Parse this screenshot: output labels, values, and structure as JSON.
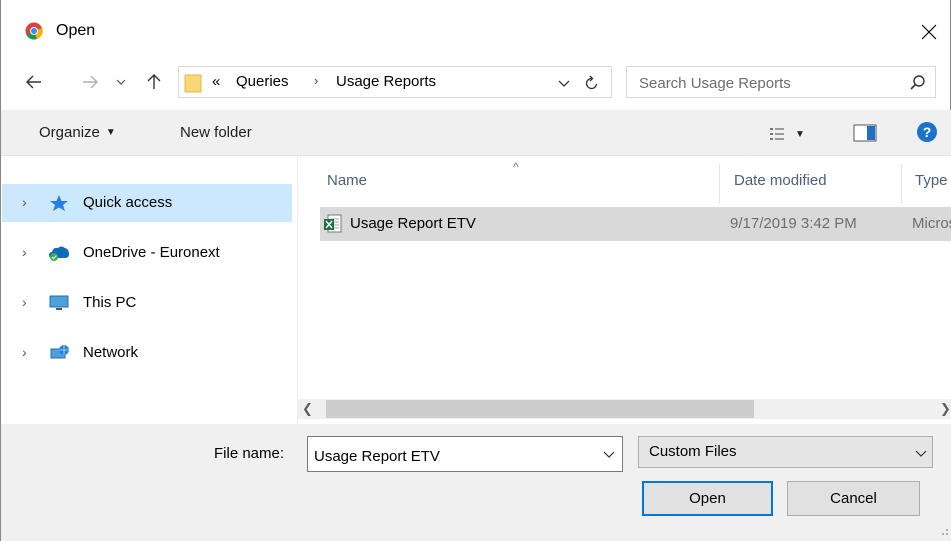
{
  "window": {
    "title": "Open",
    "app_icon": "chrome-icon",
    "close_icon": "close-icon"
  },
  "nav": {
    "back_icon": "back-arrow-icon",
    "forward_icon": "forward-arrow-icon",
    "recent_icon": "chevron-down-icon",
    "up_icon": "up-arrow-icon",
    "overflow": "«",
    "breadcrumbs": [
      "Queries",
      "Usage Reports"
    ],
    "refresh_icon": "refresh-icon",
    "search_placeholder": "Search Usage Reports"
  },
  "commandbar": {
    "organize_label": "Organize",
    "new_folder_label": "New folder",
    "help_label": "?"
  },
  "navpane": {
    "items": [
      {
        "label": "Quick access",
        "icon": "star-icon",
        "selected": true
      },
      {
        "label": "OneDrive - Euronext",
        "icon": "onedrive-icon",
        "selected": false
      },
      {
        "label": "This PC",
        "icon": "computer-icon",
        "selected": false
      },
      {
        "label": "Network",
        "icon": "network-icon",
        "selected": false
      }
    ]
  },
  "filelist": {
    "columns": {
      "name": "Name",
      "date": "Date modified",
      "type": "Type"
    },
    "rows": [
      {
        "name": "Usage Report ETV",
        "date": "9/17/2019 3:42 PM",
        "type": "Microsoft Excel Query"
      }
    ]
  },
  "bottom": {
    "filename_label": "File name:",
    "filename_value": "Usage Report ETV",
    "filter_value": "Custom Files",
    "open_label": "Open",
    "cancel_label": "Cancel"
  },
  "colors": {
    "selection_nav": "#cce8ff",
    "selection_row": "#d9d9d9",
    "chrome_bg": "#f0f0f0",
    "accent": "#0078d7"
  }
}
